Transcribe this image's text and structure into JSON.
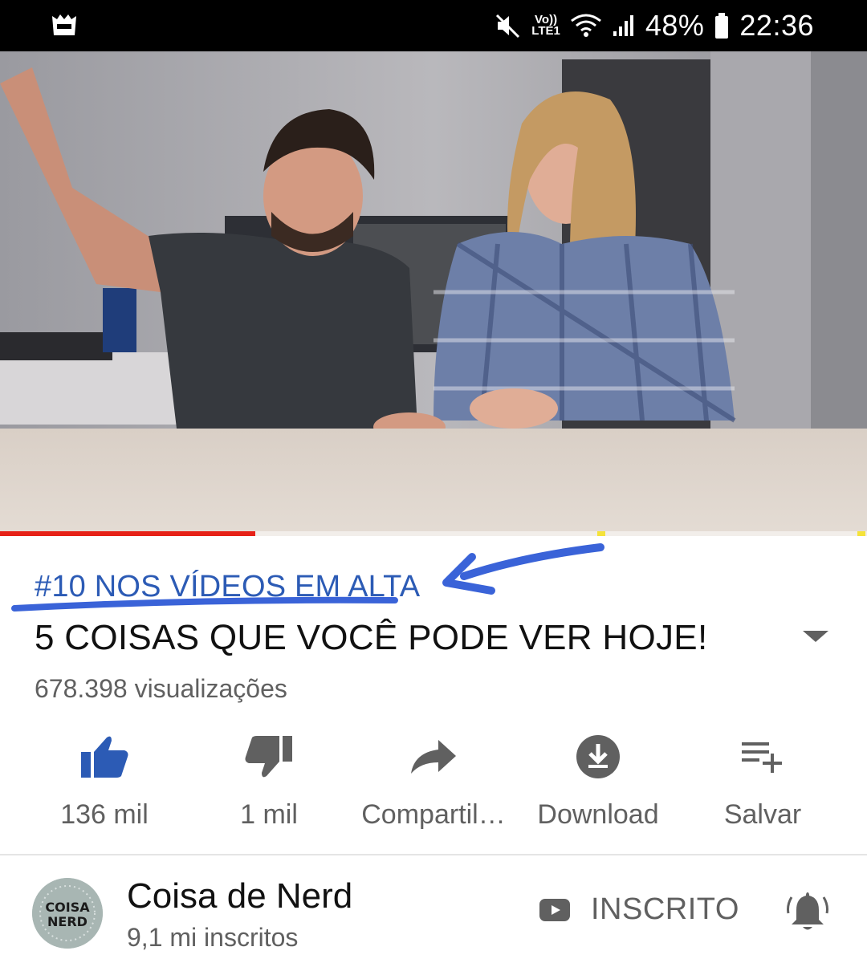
{
  "status_bar": {
    "battery": "48%",
    "time": "22:36",
    "network_label": "Vo))\nLTE1",
    "icons": [
      "app-notification-icon",
      "mute-icon",
      "volte-icon",
      "wifi-icon",
      "signal-icon",
      "battery-icon"
    ]
  },
  "video": {
    "progress": 0.294,
    "buffered": 0.32,
    "colors": {
      "played": "#e62117",
      "marker": "#f5e33a"
    }
  },
  "info": {
    "trending_label": "#10 NOS VÍDEOS EM ALTA",
    "title": "5 COISAS QUE VOCÊ PODE VER HOJE!",
    "views": "678.398 visualizações"
  },
  "actions": [
    {
      "icon": "thumbs-up-icon",
      "label": "136 mil",
      "color": "#2c5bb5"
    },
    {
      "icon": "thumbs-down-icon",
      "label": "1 mil",
      "color": "#606060"
    },
    {
      "icon": "share-icon",
      "label": "Compartil…",
      "color": "#606060"
    },
    {
      "icon": "download-icon",
      "label": "Download",
      "color": "#606060"
    },
    {
      "icon": "add-to-playlist-icon",
      "label": "Salvar",
      "color": "#606060"
    }
  ],
  "channel": {
    "name": "Coisa de Nerd",
    "subscribers": "9,1 mi inscritos",
    "avatar_text": "COISA\nNERD",
    "subscribe_label": "INSCRITO",
    "icons": [
      "youtube-icon",
      "bell-icon"
    ]
  },
  "accent_colors": {
    "trending": "#2c5bb5",
    "annotation": "#3a63d8"
  }
}
